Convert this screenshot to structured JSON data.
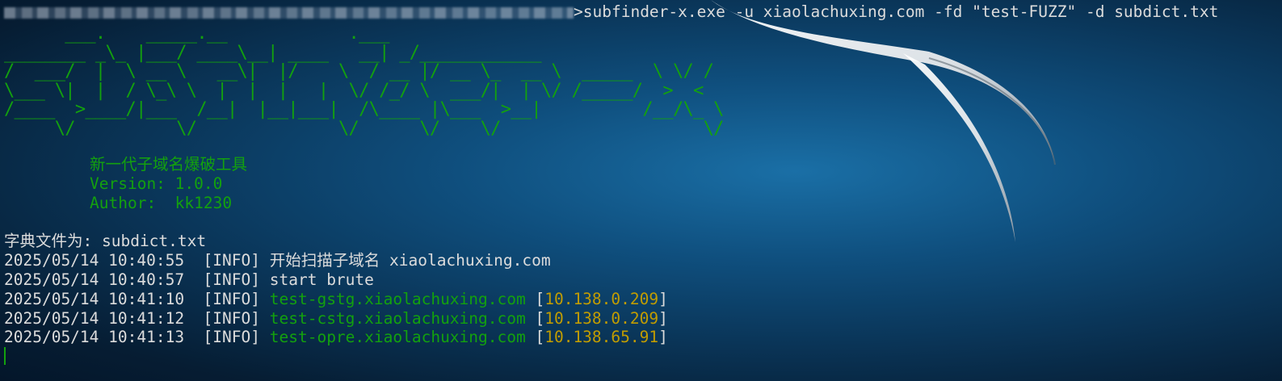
{
  "window": {
    "command": "subfinder-x.exe -u xiaolachuxing.com -fd \"test-FUZZ\" -d subdict.txt",
    "command_prefix": ">"
  },
  "banner": {
    "ascii": "      ___.    _____.__            .___\n________ _\\_ |___/ ____\\__| ____   __| _/____________\n/  ___/  |  \\ __ \\   __\\|  |/    \\  / __ |/ __ \\_  __ \\  _____  \\ \\/ /\n\\___ \\|  |  / \\_\\ \\  |  |  |   |  \\/ /_/ \\  ___/|  | \\/ /_____/  >  <\n/____  >____/|___  /__|  |__|___|  /\\____ |\\___  >__|          /__/\\_ \\\n     \\/          \\/              \\/      \\/    \\/                    \\/",
    "subtitle": "新一代子域名爆破工具",
    "version": "Version: 1.0.0",
    "author": "Author:  kk1230"
  },
  "output": {
    "dict_label": "字典文件为: ",
    "dict_file": "subdict.txt",
    "logs": [
      {
        "time": "2025/05/14 10:40:55",
        "level": "[INFO]",
        "msg": "开始扫描子域名 xiaolachuxing.com"
      },
      {
        "time": "2025/05/14 10:40:57",
        "level": "[INFO]",
        "msg": "start brute"
      },
      {
        "time": "2025/05/14 10:41:10",
        "level": "[INFO]",
        "domain": "test-gstg.xiaolachuxing.com",
        "ip": "10.138.0.209"
      },
      {
        "time": "2025/05/14 10:41:12",
        "level": "[INFO]",
        "domain": "test-cstg.xiaolachuxing.com",
        "ip": "10.138.0.209"
      },
      {
        "time": "2025/05/14 10:41:13",
        "level": "[INFO]",
        "domain": "test-opre.xiaolachuxing.com",
        "ip": "10.138.65.91"
      }
    ]
  },
  "colors": {
    "text": "#dcdcdc",
    "green": "#13a10e",
    "orange": "#c19c00"
  }
}
